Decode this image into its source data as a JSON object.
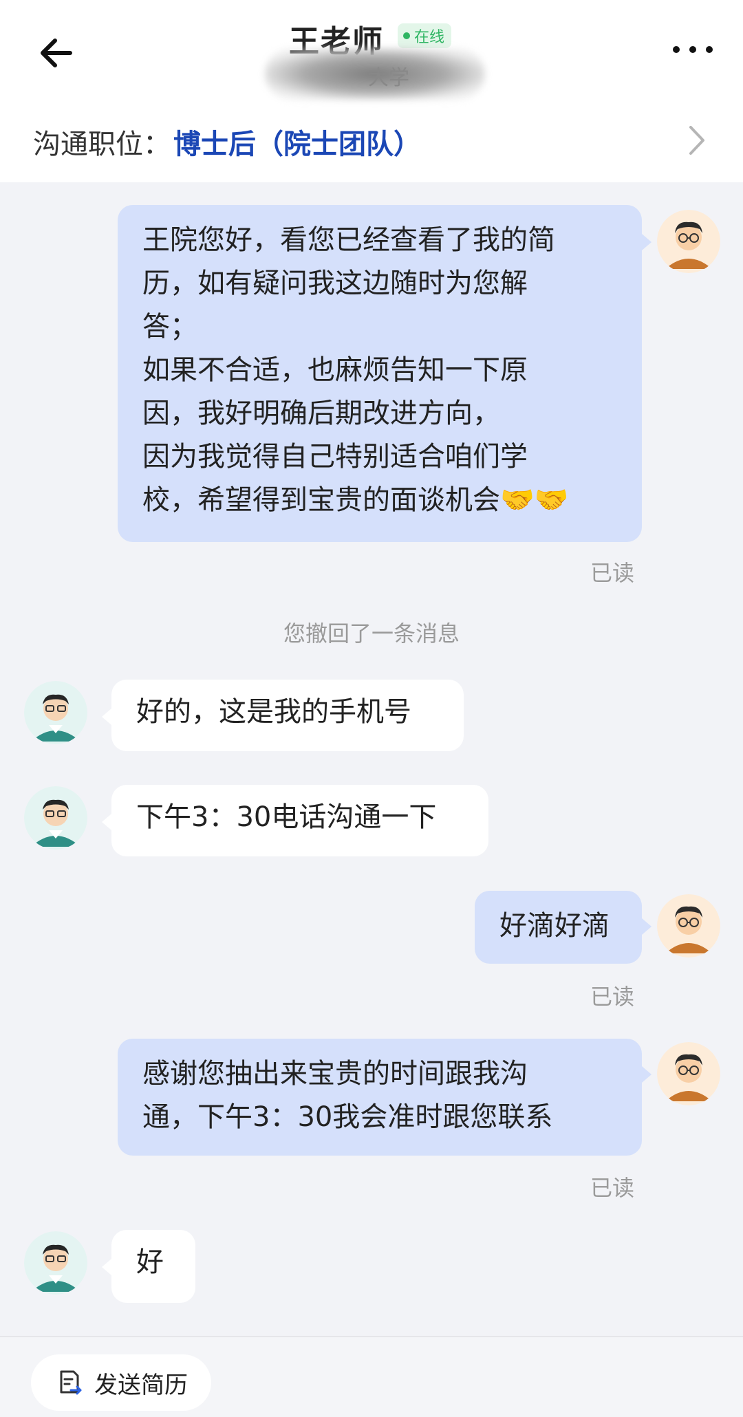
{
  "header": {
    "contact_name": "王老师",
    "status": "在线",
    "school_visible": "大学",
    "position_label": "沟通职位：",
    "position_value": "博士后（院士团队）"
  },
  "messages": [
    {
      "from": "me",
      "text": "王院您好，看您已经查看了我的简\n历，如有疑问我这边随时为您解\n答；\n如果不合适，也麻烦告知一下原\n因，我好明确后期改进方向，\n因为我觉得自己特别适合咱们学\n校，希望得到宝贵的面谈机会🤝🤝",
      "read": "已读"
    },
    {
      "system": "您撤回了一条消息"
    },
    {
      "from": "other",
      "text": "好的，这是我的手机号"
    },
    {
      "from": "other",
      "text": "下午3：30电话沟通一下"
    },
    {
      "from": "me",
      "text": "好滴好滴",
      "read": "已读"
    },
    {
      "from": "me",
      "text": "感谢您抽出来宝贵的时间跟我沟\n通，下午3：30我会准时跟您联系",
      "read": "已读"
    },
    {
      "from": "other",
      "text": "好"
    }
  ],
  "footer": {
    "send_resume_label": "发送简历"
  },
  "icons": [
    "back-arrow-icon",
    "more-dots-icon",
    "chevron-right-icon",
    "send-resume-icon"
  ],
  "colors": {
    "my_bubble": "#d5e0fb",
    "other_bubble": "#ffffff",
    "chat_background": "#f2f3f7",
    "online_green": "#2fb563",
    "position_blue": "#1b47b5"
  }
}
